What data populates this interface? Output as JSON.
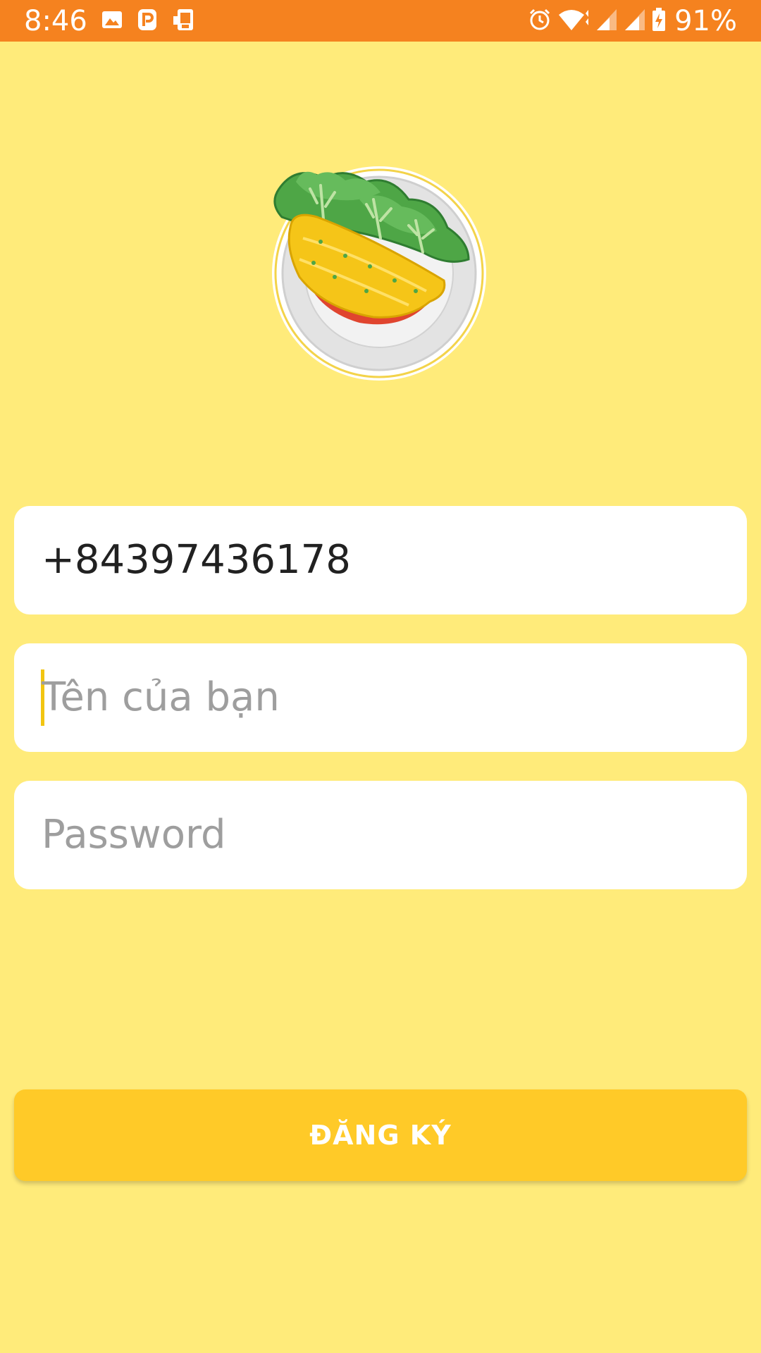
{
  "status_bar": {
    "time": "8:46",
    "battery_percent": "91%",
    "left_icons": [
      "image-icon",
      "p-app-icon",
      "phone-app-icon"
    ],
    "right_icons": [
      "alarm-icon",
      "wifi-icon",
      "signal-icon",
      "signal-icon",
      "battery-charging-icon"
    ]
  },
  "form": {
    "phone": {
      "value": "+84397436178",
      "placeholder": ""
    },
    "name": {
      "value": "",
      "placeholder": "Tên của bạn"
    },
    "password": {
      "value": "",
      "placeholder": "Password"
    }
  },
  "register_button": {
    "label": "ĐĂNG KÝ"
  },
  "colors": {
    "status_bar": "#F5821F",
    "background": "#FFEB7A",
    "field": "#FFFFFF",
    "button": "#FFCA28",
    "cursor": "#F2C511"
  }
}
